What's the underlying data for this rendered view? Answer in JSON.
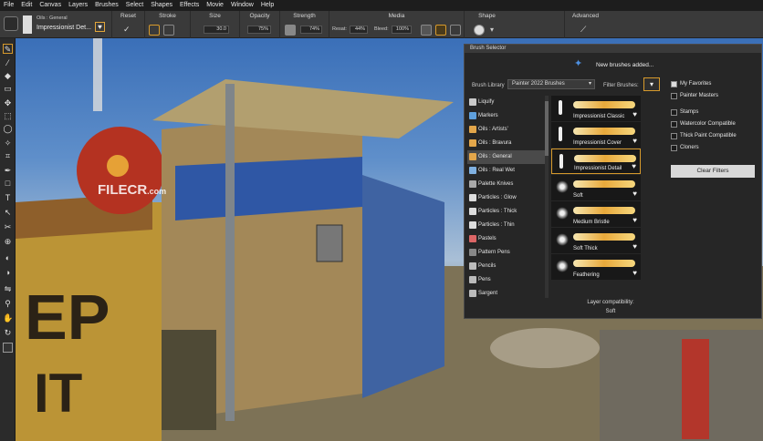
{
  "menu": [
    "File",
    "Edit",
    "Canvas",
    "Layers",
    "Brushes",
    "Select",
    "Shapes",
    "Effects",
    "Movie",
    "Window",
    "Help"
  ],
  "propbar": {
    "category": "Oils : General",
    "variant": "Impressionist Det...",
    "reset": "Reset",
    "stroke": "Stroke",
    "size": "Size",
    "size_val": "30.0",
    "opacity": "Opacity",
    "opacity_val": "75%",
    "strength": "Strength",
    "strength_val": "74%",
    "media": "Media",
    "resat": "Resat:",
    "resat_val": "44%",
    "bleed": "Bleed:",
    "bleed_val": "100%",
    "shape": "Shape",
    "advanced": "Advanced"
  },
  "canvas": {
    "watermark_main": "FILECR",
    "watermark_sub": ".com"
  },
  "panel": {
    "title": "Brush Selector",
    "new_msg": "New brushes added...",
    "library_label": "Brush Library",
    "library_value": "Painter 2022 Brushes",
    "filter_label": "Filter Brushes:",
    "categories": [
      "Liquify",
      "Markers",
      "Oils : Artists'",
      "Oils : Bravura",
      "Oils : General",
      "Oils : Real Wet",
      "Palette Knives",
      "Particles : Glow",
      "Particles : Thick",
      "Particles : Thin",
      "Pastels",
      "Pattern Pens",
      "Pencils",
      "Pens",
      "Sargent"
    ],
    "variants": [
      "Impressionist Classic",
      "Impressionist Cover",
      "Impressionist Detail",
      "Soft",
      "Medium Bristle",
      "Soft Thick",
      "Feathering"
    ],
    "filters": [
      {
        "label": "My Favorites",
        "checked": true
      },
      {
        "label": "Painter Masters",
        "checked": false
      },
      {
        "label": "Stamps",
        "checked": false
      },
      {
        "label": "Watercolor Compatible",
        "checked": false
      },
      {
        "label": "Thick Paint Compatible",
        "checked": false
      },
      {
        "label": "Cloners",
        "checked": false
      }
    ],
    "clear_btn": "Clear Filters",
    "compat_label": "Layer compatibility:",
    "compat_value": "Soft"
  }
}
